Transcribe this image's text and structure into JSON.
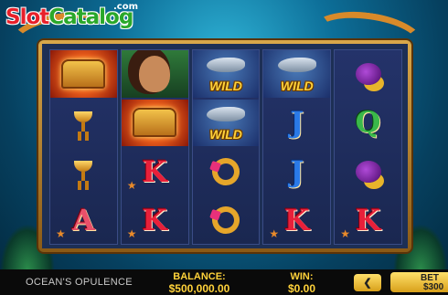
{
  "logo": {
    "part1": "Slot",
    "part2": "Catalog",
    "suffix": ".com"
  },
  "reels": [
    [
      {
        "symbol": "treasure-chest"
      },
      {
        "symbol": "golden-goblet"
      },
      {
        "symbol": "golden-goblet"
      },
      {
        "symbol": "card-a",
        "text": "A"
      }
    ],
    [
      {
        "symbol": "mermaid-lady"
      },
      {
        "symbol": "treasure-chest"
      },
      {
        "symbol": "card-k",
        "text": "K"
      },
      {
        "symbol": "card-k",
        "text": "K"
      }
    ],
    [
      {
        "symbol": "shark-wild",
        "text": "WILD"
      },
      {
        "symbol": "shark-wild",
        "text": "WILD"
      },
      {
        "symbol": "jeweled-ring"
      },
      {
        "symbol": "jeweled-ring"
      }
    ],
    [
      {
        "symbol": "shark-wild",
        "text": "WILD"
      },
      {
        "symbol": "card-j",
        "text": "J"
      },
      {
        "symbol": "card-j",
        "text": "J"
      },
      {
        "symbol": "card-k",
        "text": "K"
      }
    ],
    [
      {
        "symbol": "coin-bag"
      },
      {
        "symbol": "card-q",
        "text": "Q"
      },
      {
        "symbol": "coin-bag"
      },
      {
        "symbol": "card-k",
        "text": "K"
      }
    ]
  ],
  "status_bar": {
    "game_title": "OCEAN'S OPULENCE",
    "balance_label": "BALANCE:",
    "balance_value": "$500,000.00",
    "win_label": "WIN:",
    "win_value": "$0.00",
    "prev_glyph": "❮",
    "bet_label": "BET",
    "bet_value": "$300"
  },
  "colors": {
    "frame_gold": "#d9a84a",
    "reel_bg": "#24336a",
    "accent_yellow": "#ffd23a",
    "bar_bg": "#0a0a0a"
  }
}
